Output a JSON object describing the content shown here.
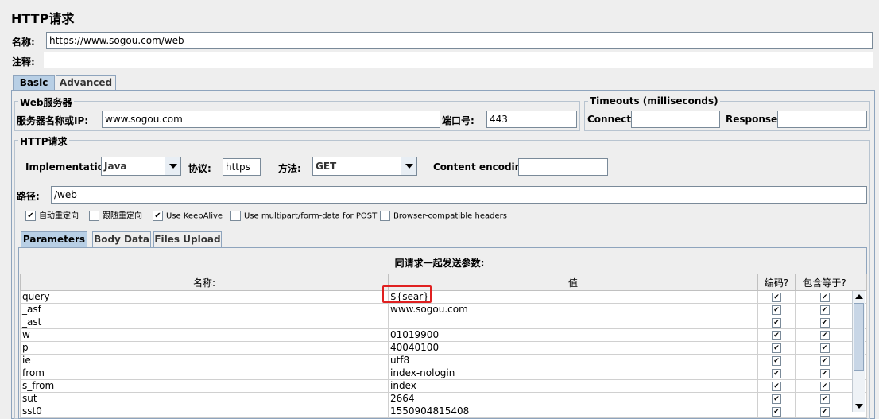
{
  "panel": {
    "title": "HTTP请求"
  },
  "name_field": {
    "label": "名称:",
    "value": "https://www.sogou.com/web"
  },
  "comment_field": {
    "label": "注释:",
    "value": ""
  },
  "main_tabs": [
    {
      "label": "Basic",
      "selected": true
    },
    {
      "label": "Advanced",
      "selected": false
    }
  ],
  "web_server": {
    "group_title": "Web服务器",
    "server_label": "服务器名称或IP:",
    "server_value": "www.sogou.com",
    "port_label": "端口号:",
    "port_value": "443"
  },
  "timeouts": {
    "group_title": "Timeouts (milliseconds)",
    "connect_label": "Connect:",
    "connect_value": "",
    "response_label": "Response:",
    "response_value": ""
  },
  "http_request": {
    "group_title": "HTTP请求",
    "impl_label": "Implementation:",
    "impl_value": "Java",
    "protocol_label": "协议:",
    "protocol_value": "https",
    "method_label": "方法:",
    "method_value": "GET",
    "encoding_label": "Content encoding:",
    "encoding_value": "",
    "path_label": "路径:",
    "path_value": "/web"
  },
  "checkboxes": [
    {
      "label": "自动重定向",
      "checked": true
    },
    {
      "label": "跟随重定向",
      "checked": false
    },
    {
      "label": "Use KeepAlive",
      "checked": true
    },
    {
      "label": "Use multipart/form-data for POST",
      "checked": false
    },
    {
      "label": "Browser-compatible headers",
      "checked": false
    }
  ],
  "sub_tabs": [
    {
      "label": "Parameters",
      "selected": true
    },
    {
      "label": "Body Data",
      "selected": false
    },
    {
      "label": "Files Upload",
      "selected": false
    }
  ],
  "params": {
    "caption": "同请求一起发送参数:",
    "columns": [
      "名称:",
      "值",
      "编码?",
      "包含等于?"
    ],
    "rows": [
      {
        "name": "query",
        "value": "${sear}"
      },
      {
        "name": "_asf",
        "value": "www.sogou.com"
      },
      {
        "name": "_ast",
        "value": ""
      },
      {
        "name": "w",
        "value": "01019900"
      },
      {
        "name": "p",
        "value": "40040100"
      },
      {
        "name": "ie",
        "value": "utf8"
      },
      {
        "name": "from",
        "value": "index-nologin"
      },
      {
        "name": "s_from",
        "value": "index"
      },
      {
        "name": "sut",
        "value": "2664"
      },
      {
        "name": "sst0",
        "value": "1550904815408"
      }
    ],
    "check_mark": "✔"
  }
}
